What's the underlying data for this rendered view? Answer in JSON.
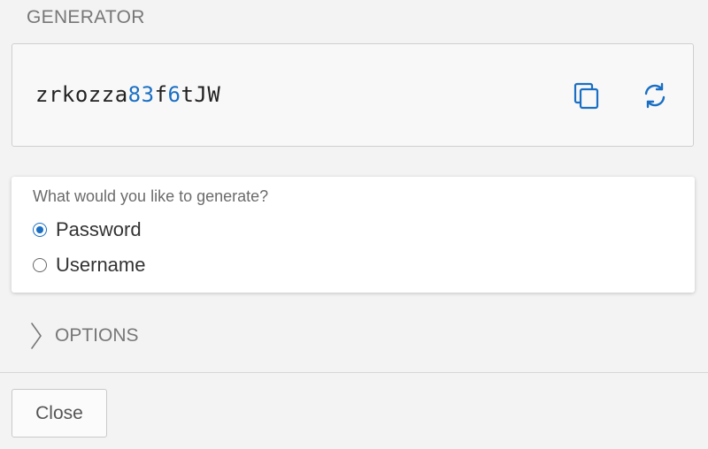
{
  "header": {
    "title": "GENERATOR"
  },
  "generated": {
    "value_parts": [
      {
        "text": "zrkozza",
        "kind": "letters"
      },
      {
        "text": "83",
        "kind": "digits"
      },
      {
        "text": "f",
        "kind": "letters"
      },
      {
        "text": "6",
        "kind": "digits"
      },
      {
        "text": "tJW",
        "kind": "letters"
      }
    ],
    "copy_icon": "copy-icon",
    "regenerate_icon": "refresh-icon"
  },
  "type_selector": {
    "question": "What would you like to generate?",
    "options": [
      {
        "label": "Password",
        "selected": true
      },
      {
        "label": "Username",
        "selected": false
      }
    ]
  },
  "options": {
    "label": "OPTIONS",
    "icon": "chevron-right-icon",
    "expanded": false
  },
  "footer": {
    "close_label": "Close"
  },
  "colors": {
    "accent": "#1a6fc4",
    "background": "#f3f3f3"
  }
}
